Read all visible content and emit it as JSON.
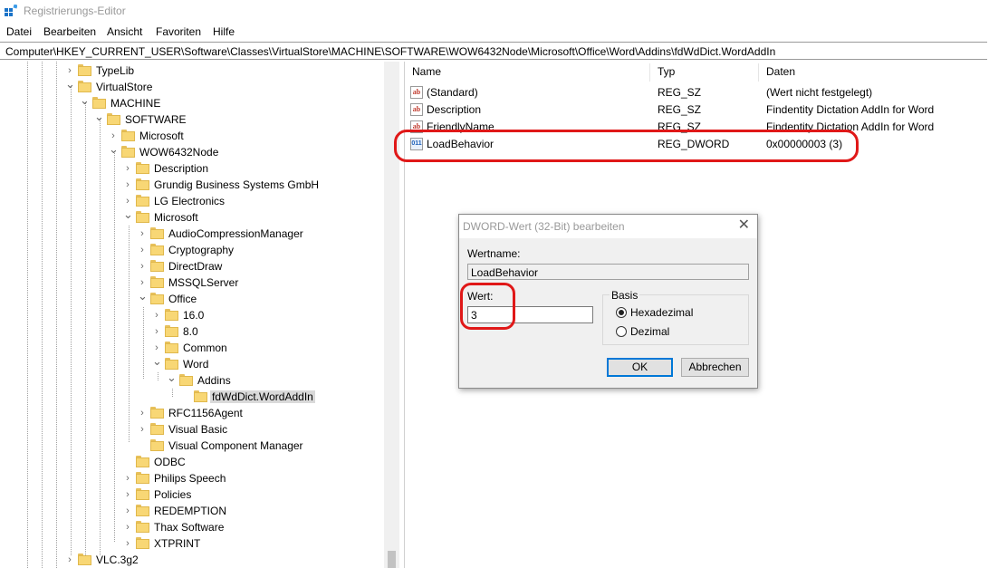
{
  "window": {
    "title": "Registrierungs-Editor"
  },
  "menu": [
    "Datei",
    "Bearbeiten",
    "Ansicht",
    "Favoriten",
    "Hilfe"
  ],
  "address": "Computer\\HKEY_CURRENT_USER\\Software\\Classes\\VirtualStore\\MACHINE\\SOFTWARE\\WOW6432Node\\Microsoft\\Office\\Word\\Addins\\fdWdDict.WordAddIn",
  "tree": [
    {
      "label": "TypeLib",
      "expanded": false
    },
    {
      "label": "VirtualStore",
      "expanded": true
    },
    {
      "label": "MACHINE",
      "expanded": true
    },
    {
      "label": "SOFTWARE",
      "expanded": true
    },
    {
      "label": "Microsoft",
      "expanded": false
    },
    {
      "label": "WOW6432Node",
      "expanded": true
    },
    {
      "label": "Description",
      "expanded": false
    },
    {
      "label": "Grundig Business Systems GmbH",
      "expanded": false
    },
    {
      "label": "LG Electronics",
      "expanded": false
    },
    {
      "label": "Microsoft",
      "expanded": true
    },
    {
      "label": "AudioCompressionManager",
      "expanded": false
    },
    {
      "label": "Cryptography",
      "expanded": false
    },
    {
      "label": "DirectDraw",
      "expanded": false
    },
    {
      "label": "MSSQLServer",
      "expanded": false
    },
    {
      "label": "Office",
      "expanded": true
    },
    {
      "label": "16.0",
      "expanded": false
    },
    {
      "label": "8.0",
      "expanded": false
    },
    {
      "label": "Common",
      "expanded": false
    },
    {
      "label": "Word",
      "expanded": true
    },
    {
      "label": "Addins",
      "expanded": true
    },
    {
      "label": "fdWdDict.WordAddIn",
      "expanded": null,
      "selected": true
    },
    {
      "label": "RFC1156Agent",
      "expanded": false
    },
    {
      "label": "Visual Basic",
      "expanded": false
    },
    {
      "label": "Visual Component Manager",
      "expanded": null
    },
    {
      "label": "ODBC",
      "expanded": null
    },
    {
      "label": "Philips Speech",
      "expanded": false
    },
    {
      "label": "Policies",
      "expanded": false
    },
    {
      "label": "REDEMPTION",
      "expanded": false
    },
    {
      "label": "Thax Software",
      "expanded": false
    },
    {
      "label": "XTPRINT",
      "expanded": false
    },
    {
      "label": "VLC.3g2",
      "expanded": false
    }
  ],
  "list": {
    "columns": [
      "Name",
      "Typ",
      "Daten"
    ],
    "rows": [
      {
        "name": "(Standard)",
        "type": "REG_SZ",
        "data": "(Wert nicht festgelegt)",
        "icon": "string-value-icon"
      },
      {
        "name": "Description",
        "type": "REG_SZ",
        "data": "Findentity Dictation AddIn for Word",
        "icon": "string-value-icon"
      },
      {
        "name": "FriendlyName",
        "type": "REG_SZ",
        "data": "Findentity Dictation AddIn for Word",
        "icon": "string-value-icon"
      },
      {
        "name": "LoadBehavior",
        "type": "REG_DWORD",
        "data": "0x00000003 (3)",
        "icon": "dword-value-icon"
      }
    ]
  },
  "dialog": {
    "title": "DWORD-Wert (32-Bit) bearbeiten",
    "name_label": "Wertname:",
    "name_value": "LoadBehavior",
    "value_label": "Wert:",
    "value_value": "3",
    "base_label": "Basis",
    "hex_label": "Hexadezimal",
    "dec_label": "Dezimal",
    "hex_checked": true,
    "ok_label": "OK",
    "cancel_label": "Abbrechen"
  },
  "colors": {
    "highlight": "#e01818",
    "folder": "#f8d775"
  }
}
